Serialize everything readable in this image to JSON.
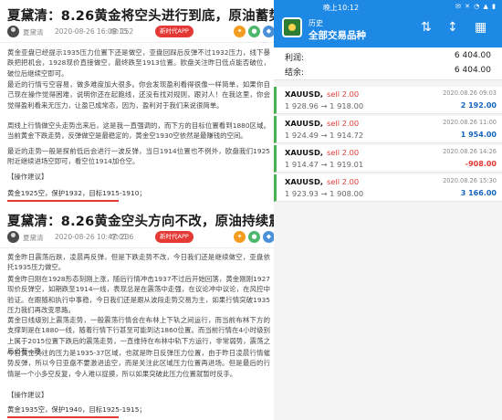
{
  "article1": {
    "title": "夏黛清：8.26黄金将空头进行到底，原油蓄势待发！",
    "author": "夏黛清",
    "date": "2020-08-26 16:08:15",
    "views": "152",
    "app_button": "新时代APP",
    "paragraphs": [
      "黄金亚盘已经提示1935压力位置下还是做空，亚盘回踩后反弹不过1932压力，线下暴跌把把机会，1928现价直接做空，最终跌至1913位置。欧盘关注昨日低点能否破位，破位后继续空即可。",
      "最近的行情亏空容易，做多难度加大很多。你会发现盈利看得很像一样简单，如果你自己现在操作觉得困难，说明你还在起跑线，还没有找对规则，跟对人！在我这里，你会觉得盈利看来无压力，让盈已成常态，因为，盈利对于我们来说很简单。",
      "周线上行情做空头走势出来后，这是我一直强调的，而下方的目标位置看到1880区域。当前黄金下跌走势，反弹做空是最稳定的，黄金空1930空依然是最赚钱的空间。",
      "最近的走势一般是探前低后会进行一波反弹，当日1914位置也不例外，欧盘我们1925附近继续进场空即可，看空位1914加仓空。"
    ],
    "advice_label": "【操作建议】",
    "advice": "黄金1925空，保护1932，目标1915-1910；"
  },
  "article2": {
    "title": "夏黛清：8.26黄金空头方向不改，原油持续震荡！",
    "author": "夏黛清",
    "date": "2020-08-26 10:47:01",
    "views": "236",
    "app_button": "新时代APP",
    "paragraphs": [
      "黄金昨日震荡后跌，凌晨再反弹，但是下跌走势不改，今日我们还是继续做空，亚盘依托1935压力做空。",
      "黄金昨日刚在1928形态刻刚上涨，随后行情冲击1937不过后开始回落，黄金刚刚1927现价反弹空，如期跌至1914一线，表现总是在震荡中走强，在议论冲中议论，在风控中验证。在跟随和执行中事稳，今日我们还是跟从波段走势交易为主，如果行情突破1935压力我们再改变思路。",
      "黄金日线级别上震荡走势，一般震荡行情会在布林上下轨之间运行，而当前布林下方的支撑到是在1880一线，随着行情下行甚至可能到达1860位置。而当前行情在4小时级别上属于2015位置下跌后的震荡走势，一直维持在布林中轨下方运行，非常弱势，震荡之后必有一跌。",
      "今日黄金关注的压力是1935-37区域，也就是昨日反弹压力位置，由于昨日凌晨行情催势反弹，所以今日亚盘不要激进追空，而是关注此区域压力位置再进场。但是最后的行情是一个小多空反复，令人难以捉摸，所以如果突破此压力位置就暂时反手。"
    ],
    "advice_label": "【操作建议】",
    "advice": "黄金1935空，保护1940，目标1925-1915；"
  },
  "phone": {
    "status_time": "晚上10:12",
    "status_icons": "✉ ✕ ◔ ▲ ▮",
    "history_label": "历史",
    "page_title": "全部交易品种",
    "icons": [
      "sort-arrows-icon",
      "sort-icon",
      "calendar-icon"
    ],
    "summary": [
      {
        "label": "利润:",
        "value": "6 404.00"
      },
      {
        "label": "结余:",
        "value": "6 404.00"
      }
    ],
    "trades": [
      {
        "symbol": "XAUUSD,",
        "side": "sell 2.00",
        "datetime": "2020.08.26 09:03",
        "price": "1 928.96 → 1 918.00",
        "profit": "2 192.00",
        "sign": "pos"
      },
      {
        "symbol": "XAUUSD,",
        "side": "sell 2.00",
        "datetime": "2020.08.26 11:00",
        "price": "1 924.49 → 1 914.72",
        "profit": "1 954.00",
        "sign": "pos"
      },
      {
        "symbol": "XAUUSD,",
        "side": "sell 2.00",
        "datetime": "2020.08.26 14:26",
        "price": "1 914.47 → 1 919.01",
        "profit": "-908.00",
        "sign": "neg"
      },
      {
        "symbol": "XAUUSD,",
        "side": "sell 2.00",
        "datetime": "2020.08.26 15:30",
        "price": "1 923.93 → 1 908.00",
        "profit": "3 166.00",
        "sign": "pos"
      }
    ]
  }
}
